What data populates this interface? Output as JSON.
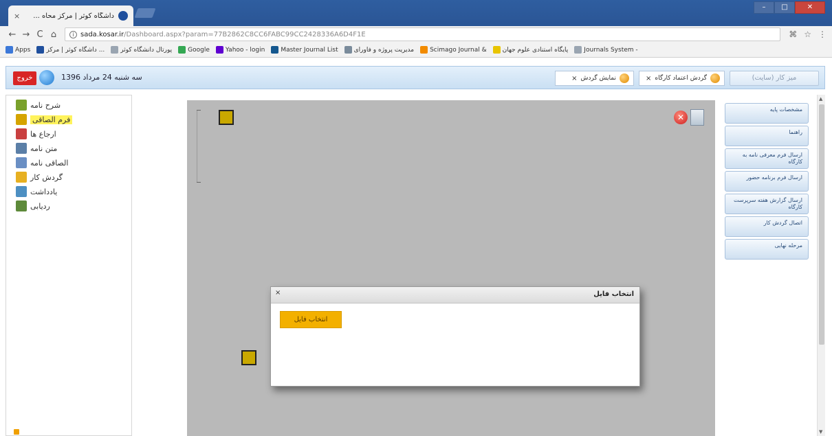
{
  "browser": {
    "tab_title": "داشگاه کوثر | مرکز محاه ...",
    "tab_close": "×",
    "window_title": "",
    "window_buttons": {
      "minimize": "–",
      "maximize": "□",
      "close": "✕"
    },
    "nav": {
      "back": "←",
      "forward": "→",
      "reload": "C",
      "home": "⌂"
    },
    "url_host": "sada.kosar.ir",
    "url_path": "/Dashboard.aspx?param=77B2862C8CC6FABC99CC2428336A6D4F1E",
    "toolbar_icons": [
      "translate-icon",
      "star-icon",
      "menu-icon"
    ],
    "bookmarks": [
      {
        "label": "Apps",
        "color": "#3c78d8"
      },
      {
        "label": "داشگاه کوثر | مرکز ...",
        "color": "#1f4f9d"
      },
      {
        "label": "پورتال دانشگاه کوثر",
        "color": "#9aa5b1"
      },
      {
        "label": "Google",
        "color": "#34a853"
      },
      {
        "label": "Yahoo - login",
        "color": "#5f01d1"
      },
      {
        "label": "Master Journal List",
        "color": "#15588f"
      },
      {
        "label": "مدیریت پروژه و فاورای",
        "color": "#7a8b9b"
      },
      {
        "label": "Scimago Journal &",
        "color": "#f28b00"
      },
      {
        "label": "پایگاه استنادی علوم جهان",
        "color": "#e8c400"
      },
      {
        "label": "Journals System -",
        "color": "#9aa5b1"
      }
    ]
  },
  "header": {
    "exit_label": "خروج",
    "date_text": "سه شنبه 24 مرداد 1396",
    "tabs": [
      {
        "label": "نمایش گردش",
        "close": "×"
      },
      {
        "label": "گردش اعتماد کارگاه",
        "close": "×"
      }
    ],
    "module_button": "میز کار (سایت)"
  },
  "left_menu": [
    {
      "label": "شرح نامه",
      "color": "#7aa12c",
      "selected": false
    },
    {
      "label": "فرم الصاقی",
      "color": "#d5a400",
      "selected": true
    },
    {
      "label": "ارجاع ها",
      "color": "#c94040",
      "selected": false
    },
    {
      "label": "متن نامه",
      "color": "#5b7fa7",
      "selected": false
    },
    {
      "label": "الصاقی نامه",
      "color": "#6a8fc4",
      "selected": false
    },
    {
      "label": "گردش کار",
      "color": "#e7b021",
      "selected": false
    },
    {
      "label": "یادداشت",
      "color": "#4d8fc2",
      "selected": false
    },
    {
      "label": "ردیابی",
      "color": "#5d8a3a",
      "selected": false
    }
  ],
  "dialog": {
    "title": "انتخاب فایل",
    "close": "×",
    "choose_button": "انتخاب فایل"
  },
  "right_nav": [
    {
      "label": "مشخصات پایه",
      "active": false
    },
    {
      "label": "راهنما",
      "active": false
    },
    {
      "label": "ارسال فرم معرفی نامه به کارگاه",
      "active": false
    },
    {
      "label": "ارسال فرم برنامه حضور",
      "active": false
    },
    {
      "label": "ارسال گزارش هفته سرپرست کارگاه",
      "active": false
    },
    {
      "label": "اتصال گردش کار",
      "active": false
    },
    {
      "label": "مرحله نهایی",
      "active": false
    }
  ],
  "error_icon_glyph": "✕"
}
